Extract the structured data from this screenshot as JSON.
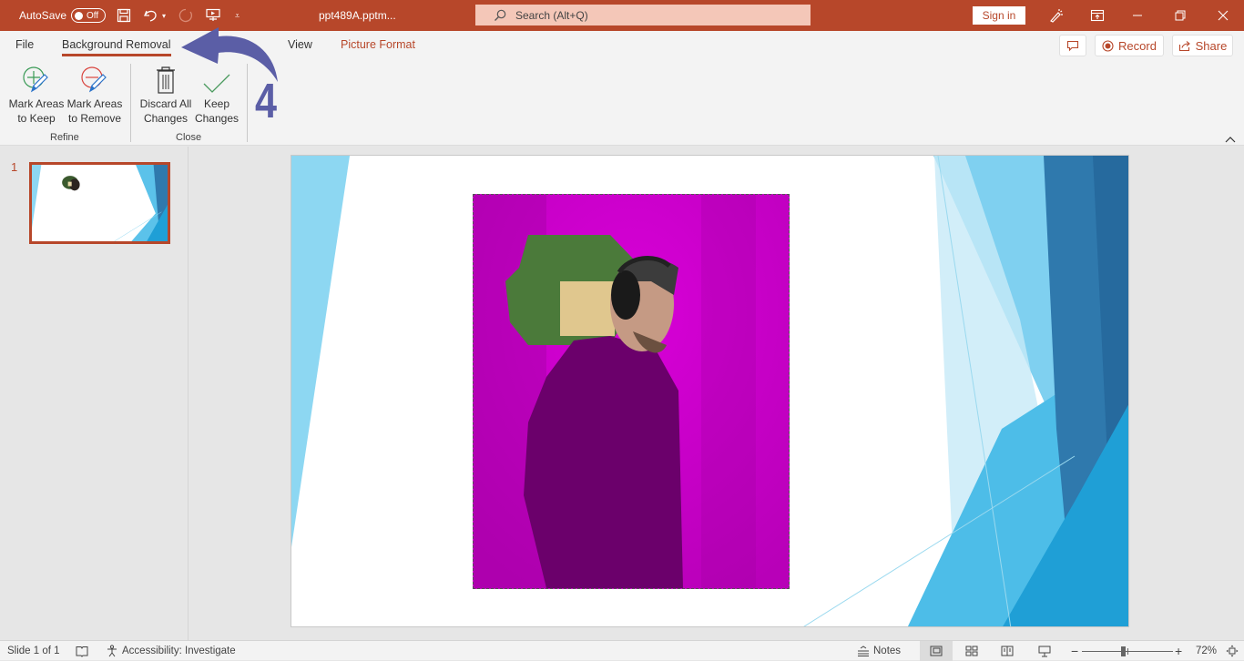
{
  "titlebar": {
    "autosave_label": "AutoSave",
    "autosave_state": "Off",
    "filename": "ppt489A.pptm...",
    "search_placeholder": "Search (Alt+Q)",
    "signin_label": "Sign in",
    "icons": [
      "save-icon",
      "undo-icon",
      "undo-dropdown-icon",
      "redo-icon",
      "present-from-beginning-icon",
      "customize-toolbar-icon",
      "designer-icon",
      "ribbon-display-icon",
      "minimize-icon",
      "restore-icon",
      "close-icon"
    ],
    "brand_color": "#b7472a"
  },
  "ribbon": {
    "tabs": [
      {
        "label": "File"
      },
      {
        "label": "Background Removal",
        "active": true
      },
      {
        "label": "View"
      },
      {
        "label": "Picture Format",
        "contextual": true
      }
    ],
    "comments_icon": "comment-icon",
    "record_label": "Record",
    "share_label": "Share",
    "groups": [
      {
        "label": "Refine",
        "buttons": [
          {
            "label_line1": "Mark Areas",
            "label_line2": "to Keep",
            "icon": "mark-keep-icon"
          },
          {
            "label_line1": "Mark Areas",
            "label_line2": "to Remove",
            "icon": "mark-remove-icon"
          }
        ]
      },
      {
        "label": "Close",
        "buttons": [
          {
            "label_line1": "Discard All",
            "label_line2": "Changes",
            "icon": "trash-icon"
          },
          {
            "label_line1": "Keep",
            "label_line2": "Changes",
            "icon": "checkmark-icon"
          }
        ]
      }
    ],
    "annotation_step": "4",
    "annotation_color": "#5b5ea6"
  },
  "slides_pane": {
    "slides": [
      {
        "number": "1",
        "selected": true
      }
    ]
  },
  "slide": {
    "removal_overlay_color": "#c800c8",
    "theme_colors": [
      "#8dd7f2",
      "#5bc2ea",
      "#2f79ad",
      "#1f9fd6"
    ]
  },
  "statusbar": {
    "slide_info": "Slide 1 of 1",
    "accessibility": "Accessibility: Investigate",
    "notes_label": "Notes",
    "zoom_level": "72%",
    "zoom_fraction": 0.45
  }
}
